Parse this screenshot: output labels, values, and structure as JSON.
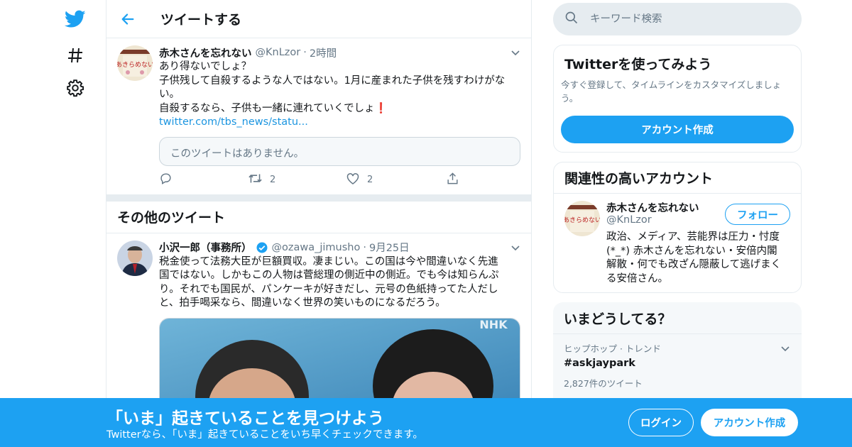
{
  "colors": {
    "accent": "#1da1f2",
    "link": "#1b95e0",
    "muted": "#657786",
    "border": "#e6ecf0",
    "like_red": "#e0245e"
  },
  "nav": {
    "icons": [
      "twitter-bird-icon",
      "hashtag-icon",
      "gear-icon"
    ]
  },
  "header": {
    "title": "ツイートする"
  },
  "tweet": {
    "name": "赤木さんを忘れない",
    "handle": "@KnLzor",
    "dot": "·",
    "time": "2時間",
    "text": "あり得ないでしょ？\n子供残して自殺するような人ではない。1月に産まれた子供を残すわけがな\nい。\n自殺するなら、子供も一緒に連れていくでしょ❗",
    "link": "twitter.com/tbs_news/statu...",
    "quote_unavailable": "このツイートはありません。",
    "retweets": "2",
    "likes": "2"
  },
  "more": {
    "title": "その他のツイート",
    "tweet": {
      "name": "小沢一郎（事務所）",
      "handle": "@ozawa_jimusho",
      "dot": "·",
      "time": "9月25日",
      "text": "税金使って法務大臣が巨額買収。凄まじい。この国は今や間違いなく先進\n国ではない。しかもこの人物は菅総理の側近中の側近。でも今は知らんぷ\nり。それでも国民が、パンケーキが好きだし、元号の色紙持ってた人だし\nと、拍手喝采なら、間違いなく世界の笑いものになるだろう。",
      "media_watermark": "NHK"
    }
  },
  "search": {
    "placeholder": "キーワード検索"
  },
  "signup_card": {
    "title": "Twitterを使ってみよう",
    "desc": "今すぐ登録して、タイムラインをカスタマイズしましょ\nう。",
    "button": "アカウント作成"
  },
  "relevant_card": {
    "title": "関連性の高いアカウント",
    "name": "赤木さんを忘れない",
    "handle": "@KnLzor",
    "follow": "フォロー",
    "bio": "政治、メディア、芸能界は圧力・忖度\n(*_*) 赤木さんを忘れない・安倍内閣\n解散・何でも改ざん隠蔽して逃げまく\nる安倍さん。"
  },
  "trends_card": {
    "title": "いまどうしてる？",
    "context": "ヒップホップ · トレンド",
    "topic": "#askjaypark",
    "count": "2,827件のツイート"
  },
  "bottom_bar": {
    "title": "「いま」起きていることを見つけよう",
    "subtitle": "Twitterなら、「いま」起きていることをいち早くチェックできます。",
    "login": "ログイン",
    "signup": "アカウント作成"
  }
}
